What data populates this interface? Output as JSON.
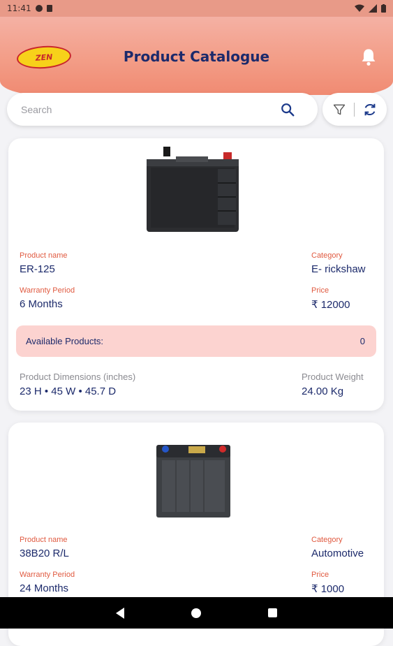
{
  "status_bar": {
    "time": "11:41"
  },
  "header": {
    "logo_text": "ZEN",
    "title": "Product Catalogue"
  },
  "search": {
    "placeholder": "Search",
    "value": ""
  },
  "products": [
    {
      "name_label": "Product name",
      "name": "ER-125",
      "category_label": "Category",
      "category": "E- rickshaw",
      "warranty_label": "Warranty Period",
      "warranty": "6 Months",
      "price_label": "Price",
      "price": "₹ 12000",
      "available_label": "Available Products:",
      "available": "0",
      "dimensions_label": "Product Dimensions (inches)",
      "dimensions": "23 H • 45 W • 45.7 D",
      "weight_label": "Product Weight",
      "weight": "24.00 Kg"
    },
    {
      "name_label": "Product name",
      "name": "38B20 R/L",
      "category_label": "Category",
      "category": "Automotive",
      "warranty_label": "Warranty Period",
      "warranty": "24 Months",
      "price_label": "Price",
      "price": "₹ 1000"
    }
  ],
  "colors": {
    "accent": "#1c2a6b",
    "label": "#e05a40",
    "header": "#f39d87",
    "available_bg": "#fcd3d0"
  }
}
